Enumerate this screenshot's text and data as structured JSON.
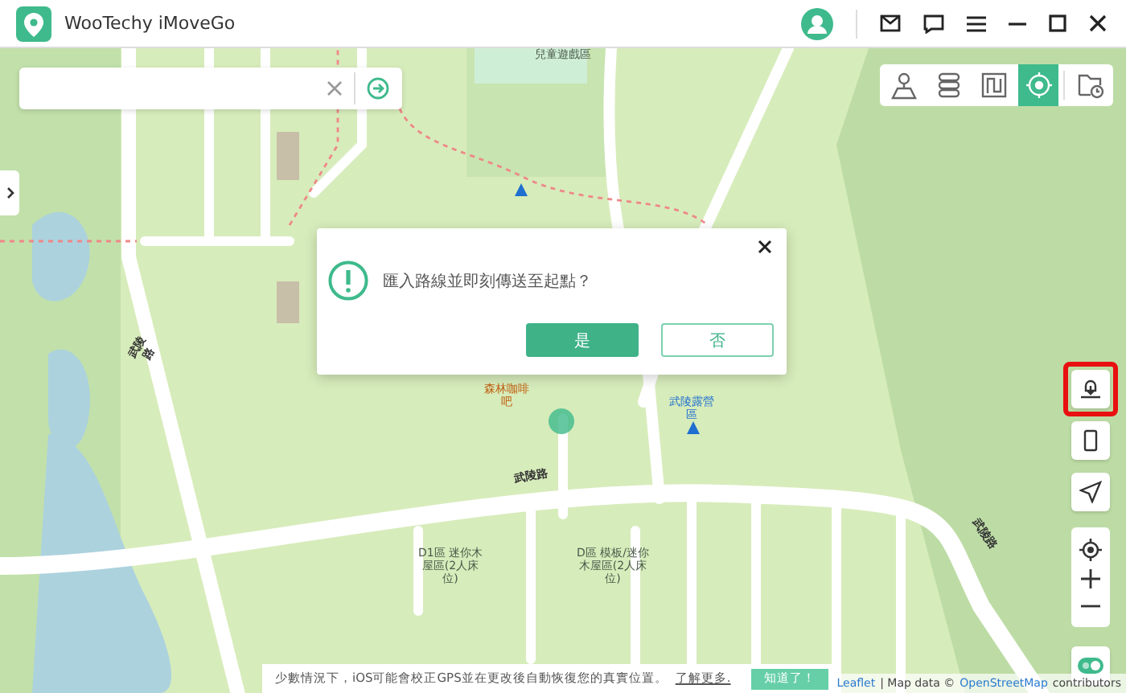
{
  "window": {
    "title": "WooTechy iMoveGo"
  },
  "mode_tools": [
    {
      "kind": "map-pin",
      "selected": false
    },
    {
      "kind": "multi-route",
      "selected": false
    },
    {
      "kind": "route",
      "selected": false
    },
    {
      "kind": "teleport",
      "selected": true
    },
    {
      "kind": "history",
      "selected": false
    }
  ],
  "side_tools": [
    {
      "kind": "import",
      "highlighted": true
    },
    {
      "kind": "device",
      "highlighted": false
    },
    {
      "kind": "navigate",
      "highlighted": false
    }
  ],
  "map_labels": [
    {
      "text": "兒童遊戲區",
      "kind": "place"
    },
    {
      "text": "武陵路",
      "kind": "road"
    },
    {
      "text": "武陵路",
      "kind": "road"
    },
    {
      "text": "武陵路",
      "kind": "road"
    },
    {
      "text": "森林咖啡吧",
      "kind": "poi"
    },
    {
      "text": "武陵露營區",
      "kind": "camp"
    },
    {
      "text": "D1區 迷你木屋區(2人床位)",
      "kind": "place"
    },
    {
      "text": "D區 模板/迷你木屋區(2人床位)",
      "kind": "place"
    }
  ],
  "dialog": {
    "message": "匯入路線並即刻傳送至起點？",
    "confirm": "是",
    "cancel": "否"
  },
  "notice": {
    "text": "少數情況下，iOS可能會校正GPS並在更改後自動恢復您的真實位置。",
    "link": "了解更多.",
    "button": "知道了！"
  },
  "attribution": {
    "leaflet": "Leaflet",
    "middle": "| Map data ©",
    "osm": "OpenStreetMap",
    "end": "contributors"
  }
}
